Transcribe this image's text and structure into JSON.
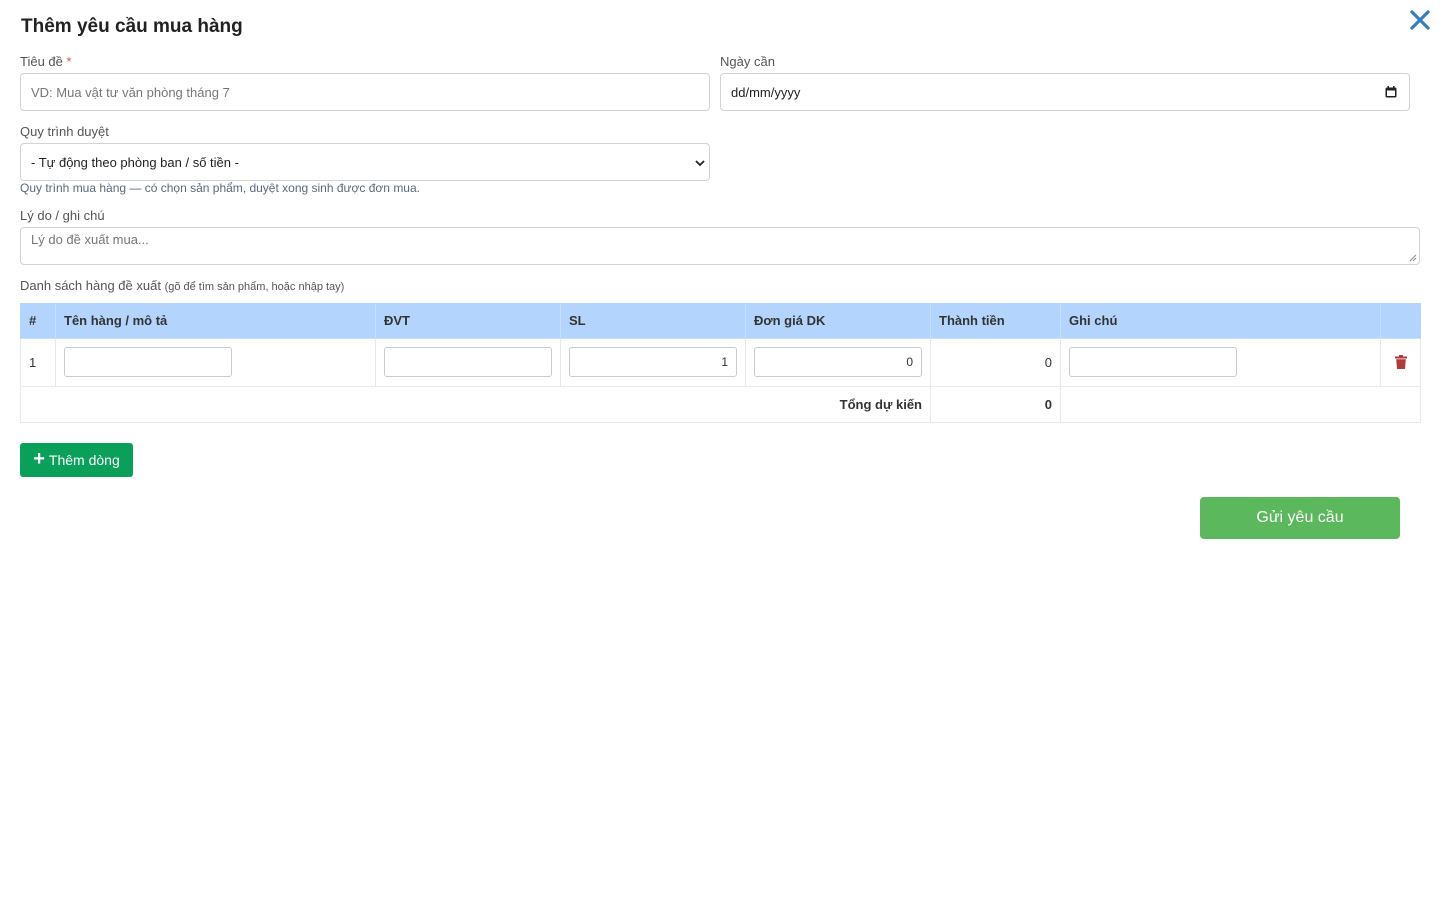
{
  "dialog": {
    "title": "Thêm yêu cầu mua hàng"
  },
  "form": {
    "title_field": {
      "label": "Tiêu đề",
      "required_mark": "*",
      "placeholder": "VD: Mua vật tư văn phòng tháng 7",
      "value": ""
    },
    "date_field": {
      "label": "Ngày cần",
      "placeholder": "dd/mm/yyyy"
    },
    "workflow_field": {
      "label": "Quy trình duyệt",
      "selected": "- Tự động theo phòng ban / số tiền -",
      "hint": "Quy trình mua hàng — có chọn sản phẩm, duyệt xong sinh được đơn mua."
    },
    "reason_field": {
      "label": "Lý do / ghi chú",
      "placeholder": "Lý do đề xuất mua..."
    }
  },
  "items_section": {
    "label": "Danh sách hàng đề xuất",
    "sublabel": "(gõ để tìm sản phẩm, hoặc nhập tay)",
    "columns": [
      "#",
      "Tên hàng / mô tả",
      "ĐVT",
      "SL",
      "Đơn giá DK",
      "Thành tiền",
      "Ghi chú",
      ""
    ],
    "rows": [
      {
        "index": "1",
        "name": "",
        "unit": "",
        "qty": "1",
        "unit_price": "0",
        "amount": "0",
        "note": ""
      }
    ],
    "total_label": "Tổng dự kiến",
    "total_value": "0"
  },
  "actions": {
    "add_row_label": "Thêm dòng",
    "submit_label": "Gửi yêu cầu"
  },
  "colors": {
    "table_header": "#b3d4fc",
    "add_button": "#0aa05a",
    "submit_button": "#5cb85c",
    "close_icon": "#2f7fc1",
    "trash_icon": "#b33a3a"
  }
}
